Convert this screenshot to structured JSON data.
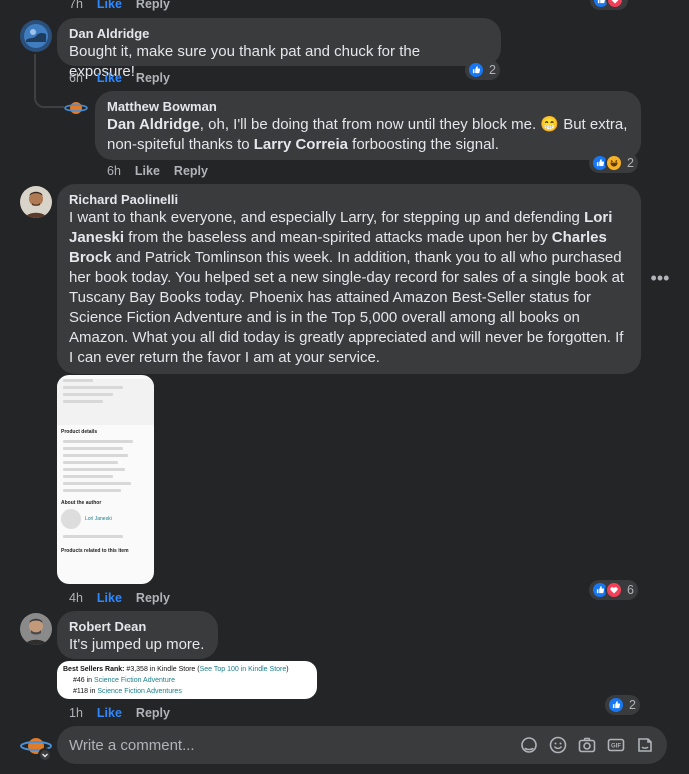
{
  "colors": {
    "background": "#242526",
    "bubble": "#3a3b3c",
    "like_blue": "#2e89ff",
    "muted": "#b0b3b8",
    "text": "#e4e6eb"
  },
  "top_actions": {
    "time": "7h",
    "like": "Like",
    "reply": "Reply"
  },
  "comments": [
    {
      "name": "Dan Aldridge",
      "text": "Bought it, make sure you thank pat and chuck for the exposure!",
      "time": "6h",
      "like": "Like",
      "reply": "Reply",
      "reaction_count": "2",
      "reaction_icons": [
        "like-icon"
      ]
    },
    {
      "name": "Matthew Bowman",
      "mention": "Dan Aldridge",
      "text_part1": ", oh, I'll be doing that from now until they block me. ",
      "emoji": "😁",
      "text_part2": " But extra, non-spiteful thanks to ",
      "mention2": "Larry Correia",
      "text_part3": " forboosting the signal.",
      "time": "6h",
      "like": "Like",
      "reply": "Reply",
      "reaction_count": "2",
      "reaction_icons": [
        "like-icon",
        "haha-icon"
      ]
    },
    {
      "name": "Richard Paolinelli",
      "text_part1": "I want to thank everyone, and especially Larry, for stepping up and defending ",
      "mention1": "Lori Janeski",
      "text_part2": " from the baseless and mean-spirited attacks made upon her by ",
      "mention2": "Charles Brock",
      "text_part3": " and Patrick Tomlinson this week. In addition, thank you to all who purchased her book today. You helped set a new single-day record for sales of a single book at Tuscany Bay Books today. Phoenix has attained Amazon Best-Seller status for Science Fiction Adventure and is in the Top 5,000 overall among all books on Amazon. What you all did today is greatly appreciated and will never be forgotten. If I can ever return the favor I am at your service.",
      "time": "4h",
      "like": "Like",
      "reply": "Reply",
      "reaction_count": "6",
      "reaction_icons": [
        "like-icon",
        "love-icon"
      ],
      "attachment": {
        "sections": [
          "Product details",
          "About the author",
          "Lori Janeski",
          "Products related to this item"
        ]
      }
    },
    {
      "name": "Robert Dean",
      "text": "It's jumped up more.",
      "time": "1h",
      "like": "Like",
      "reply": "Reply",
      "reaction_count": "2",
      "reaction_icons": [
        "like-icon"
      ],
      "rank_image": {
        "line1_label": "Best Sellers Rank:",
        "line1_value": " #3,358 in Kindle Store (",
        "line1_link": "See Top 100 in Kindle Store",
        "line1_end": ")",
        "line2_value": "#46 in ",
        "line2_link": "Science Fiction Adventure",
        "line3_value": "#118 in ",
        "line3_link": "Science Fiction Adventures"
      }
    }
  ],
  "composer": {
    "placeholder": "Write a comment..."
  }
}
